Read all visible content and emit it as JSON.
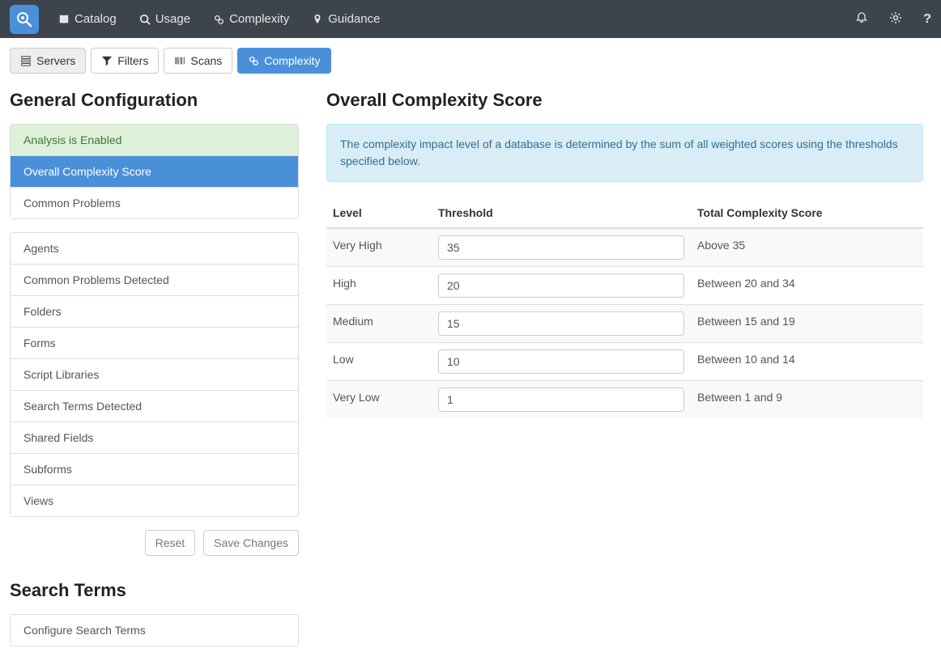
{
  "navbar": {
    "items": [
      {
        "label": "Catalog"
      },
      {
        "label": "Usage"
      },
      {
        "label": "Complexity"
      },
      {
        "label": "Guidance"
      }
    ]
  },
  "tabs": {
    "servers": "Servers",
    "filters": "Filters",
    "scans": "Scans",
    "complexity": "Complexity"
  },
  "sidebar": {
    "general_heading": "General Configuration",
    "group1": [
      "Analysis is Enabled",
      "Overall Complexity Score",
      "Common Problems"
    ],
    "group2": [
      "Agents",
      "Common Problems Detected",
      "Folders",
      "Forms",
      "Script Libraries",
      "Search Terms Detected",
      "Shared Fields",
      "Subforms",
      "Views"
    ],
    "reset": "Reset",
    "save": "Save Changes",
    "search_heading": "Search Terms",
    "search_item": "Configure Search Terms"
  },
  "main": {
    "heading": "Overall Complexity Score",
    "info": "The complexity impact level of a database is determined by the sum of all weighted scores using the thresholds specified below.",
    "columns": {
      "level": "Level",
      "threshold": "Threshold",
      "total": "Total Complexity Score"
    },
    "rows": [
      {
        "level": "Very High",
        "threshold": "35",
        "desc": "Above 35"
      },
      {
        "level": "High",
        "threshold": "20",
        "desc": "Between 20 and 34"
      },
      {
        "level": "Medium",
        "threshold": "15",
        "desc": "Between 15 and 19"
      },
      {
        "level": "Low",
        "threshold": "10",
        "desc": "Between 10 and 14"
      },
      {
        "level": "Very Low",
        "threshold": "1",
        "desc": "Between 1 and 9"
      }
    ]
  }
}
